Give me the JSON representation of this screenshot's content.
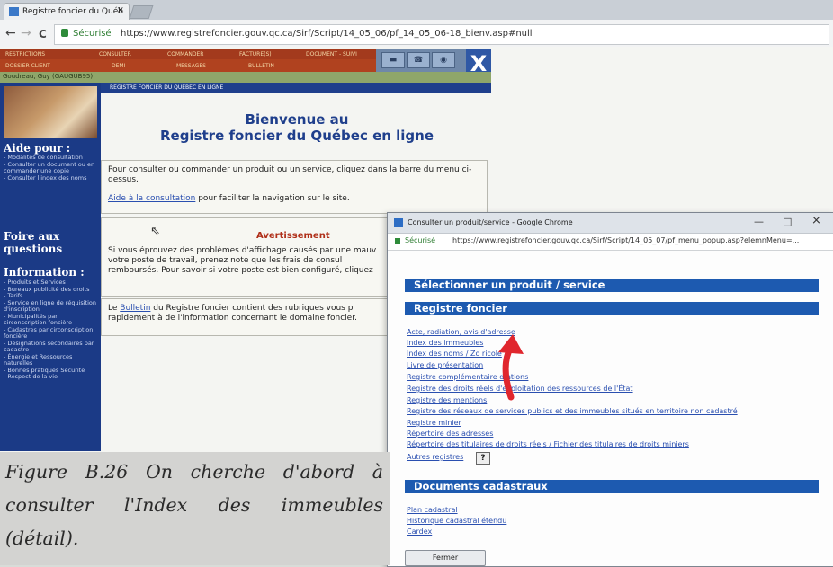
{
  "browser": {
    "tab_title": "Registre foncier du Québ",
    "tab_close": "×",
    "nav_back": "←",
    "nav_forward": "→",
    "nav_reload": "C",
    "security_label": "Sécurisé",
    "url": "https://www.registrefoncier.gouv.qc.ca/Sirf/Script/14_05_06/pf_14_05_06-18_bienv.asp#null"
  },
  "site_menu": {
    "row1": [
      "RESTRICTIONS",
      "CONSULTER",
      "COMMANDER",
      "FACTURE(S)",
      "DOCUMENT - SUIVI"
    ],
    "row2": [
      "DOSSIER CLIENT",
      "DEMI",
      "MESSAGES",
      "BULLETIN"
    ],
    "close_label": "X",
    "user_name": "Goudreau, Guy (GAUGUB95)",
    "banner_text": "REGISTRE FONCIER DU QUÉBEC EN LIGNE"
  },
  "sidebar": {
    "aide_title": "Aide pour :",
    "aide_items": [
      "- Modalités de consultation",
      "- Consulter un document ou en commander une copie",
      "- Consulter l'index des noms"
    ],
    "faq_title_1": "Foire aux",
    "faq_title_2": "questions",
    "info_title": "Information :",
    "info_items": [
      "- Produits et Services",
      "- Bureaux publicité des droits",
      "- Tarifs",
      "- Service en ligne de réquisition d'inscription",
      "- Municipalités par circonscription foncière",
      "- Cadastres par circonscription foncière",
      "- Désignations secondaires par cadastre",
      "- Énergie et Ressources naturelles",
      "- Bonnes pratiques Sécurité",
      "- Respect de la vie"
    ]
  },
  "main": {
    "welcome_line1": "Bienvenue au",
    "welcome_line2": "Registre foncier du Québec en ligne",
    "box1_text": "Pour consulter ou commander un produit ou un service, cliquez dans la barre du menu ci-dessus.",
    "box1_link": "Aide à la consultation",
    "box1_after_link": " pour faciliter la navigation sur le site.",
    "warning_title": "Avertissement",
    "warning_text": "Si vous éprouvez des problèmes d'affichage causés par une mauv votre poste de travail, prenez note que les frais de consul remboursés. Pour savoir si votre poste est bien configuré, cliquez",
    "bulletin_prefix": "Le ",
    "bulletin_link": "Bulletin",
    "bulletin_text": " du Registre foncier contient des rubriques vous p rapidement à de l'information concernant le domaine foncier."
  },
  "popup": {
    "title": "Consulter un produit/service - Google Chrome",
    "minimize": "—",
    "maximize": "□",
    "close": "×",
    "security_label": "Sécurisé",
    "url": "https://www.registrefoncier.gouv.qc.ca/Sirf/Script/14_05_07/pf_menu_popup.asp?elemnMenu=...",
    "select_header": "Sélectionner un produit / service",
    "registre_header": "Registre foncier",
    "registre_links": [
      "Acte, radiation, avis d'adresse",
      "Index des immeubles",
      "Index des noms / Zo        ricole",
      "Livre de présentation",
      "Registre complémentaire d        ntions",
      "Registre des droits réels d'exploitation des ressources de l'État",
      "Registre des mentions",
      "Registre des réseaux de services publics et des immeubles situés en territoire non cadastré",
      "Registre minier",
      "Répertoire des adresses",
      "Répertoire des titulaires de droits réels / Fichier des titulaires de droits miniers",
      "Autres registres"
    ],
    "help_label": "?",
    "docs_header": "Documents cadastraux",
    "docs_links": [
      "Plan cadastral",
      "Historique cadastral étendu",
      "Cardex"
    ],
    "close_button": "Fermer"
  },
  "caption": {
    "text": "Figure B.26 On cherche d'abord à consulter l'Index des immeubles (détail)."
  },
  "colors": {
    "menu_red": "#a33a1d",
    "site_blue": "#1b3a86",
    "popup_bar_blue": "#1d5ab0",
    "arrow_red": "#e0262d"
  }
}
